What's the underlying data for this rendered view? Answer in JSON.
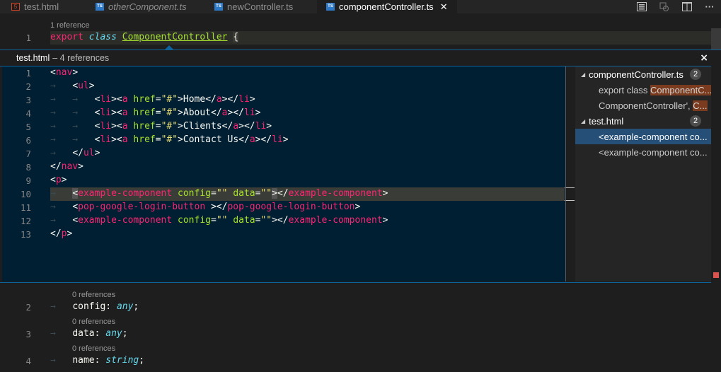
{
  "tabs": [
    {
      "label": "test.html",
      "icon": "html-file-icon",
      "italic": false
    },
    {
      "label": "otherComponent.ts",
      "icon": "ts-file-icon",
      "italic": true
    },
    {
      "label": "newController.ts",
      "icon": "ts-file-icon",
      "italic": false
    },
    {
      "label": "componentController.ts",
      "icon": "ts-file-icon",
      "italic": false,
      "active": true
    }
  ],
  "editor": {
    "codelens_top": "1 reference",
    "line1_number": "1",
    "line1": {
      "kw1": "export",
      "kw2": "class",
      "name": "ComponentController",
      "brace": "{"
    },
    "bottom": [
      {
        "codelens": "0 references",
        "number": "2",
        "name": "config",
        "type": "any"
      },
      {
        "codelens": "0 references",
        "number": "3",
        "name": "data",
        "type": "any"
      },
      {
        "codelens": "0 references",
        "number": "4",
        "name": "name",
        "type": "string"
      }
    ]
  },
  "peek": {
    "file": "test.html",
    "count": "– 4 references",
    "close": "×",
    "lines": [
      {
        "n": "1",
        "html": "nav_open"
      },
      {
        "n": "2"
      },
      {
        "n": "3"
      },
      {
        "n": "4"
      },
      {
        "n": "5"
      },
      {
        "n": "6"
      },
      {
        "n": "7"
      },
      {
        "n": "8"
      },
      {
        "n": "9"
      },
      {
        "n": "10"
      },
      {
        "n": "11"
      },
      {
        "n": "12"
      },
      {
        "n": "13"
      }
    ],
    "links": [
      "Home",
      "About",
      "Clients",
      "Contact Us"
    ],
    "components": {
      "example": "example-component",
      "pop": "pop-google-login-button",
      "config_attr": "config",
      "data_attr": "data",
      "empty": "\"\""
    },
    "side": [
      {
        "type": "file",
        "label": "componentController.ts",
        "badge": "2"
      },
      {
        "type": "ref",
        "pre": "export class ",
        "mark": "ComponentC..."
      },
      {
        "type": "ref",
        "pre": "ComponentController', ",
        "mark": "C..."
      },
      {
        "type": "file",
        "label": "test.html",
        "badge": "2"
      },
      {
        "type": "ref",
        "pre": "<example-component co...",
        "mark": "",
        "selected": true
      },
      {
        "type": "ref",
        "pre": "<example-component co...",
        "mark": ""
      }
    ]
  }
}
